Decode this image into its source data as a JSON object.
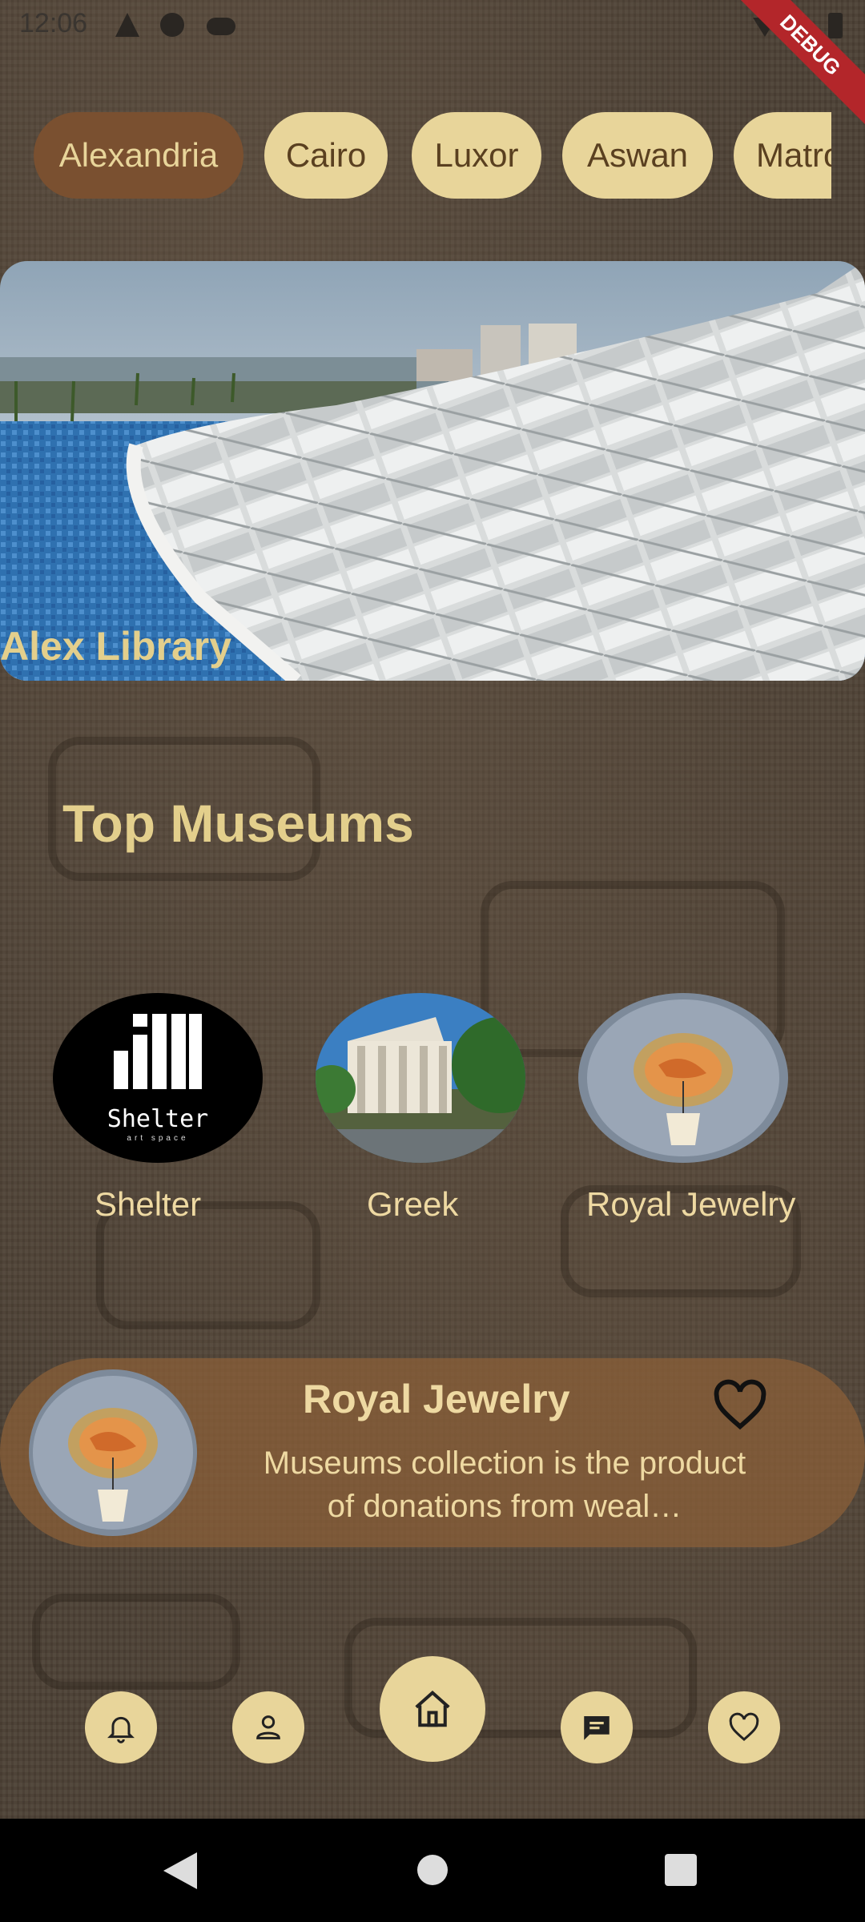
{
  "status_bar": {
    "time": "12:06",
    "debug_label": "DEBUG"
  },
  "chips": [
    {
      "label": "Alexandria",
      "active": true
    },
    {
      "label": "Cairo",
      "active": false
    },
    {
      "label": "Luxor",
      "active": false
    },
    {
      "label": "Aswan",
      "active": false
    },
    {
      "label": "Matrouh",
      "active": false
    }
  ],
  "hero": {
    "caption": "Alex Library"
  },
  "top_museums": {
    "title": "Top Museums",
    "items": [
      {
        "name": "Shelter",
        "logo_text": "Shelter",
        "logo_sub": "art space"
      },
      {
        "name": "Greek"
      },
      {
        "name": "Royal Jewelry"
      }
    ]
  },
  "featured": {
    "title": "Royal Jewelry",
    "description": "Museums collection is the product of donations from weal…"
  },
  "bottom_nav": {
    "items": [
      {
        "icon": "bell-icon"
      },
      {
        "icon": "person-icon"
      },
      {
        "icon": "home-icon"
      },
      {
        "icon": "chat-icon"
      },
      {
        "icon": "heart-icon"
      }
    ]
  },
  "colors": {
    "accent": "#e8d59a",
    "active_chip": "#7a5030",
    "text_gold": "#e3cf8c"
  }
}
